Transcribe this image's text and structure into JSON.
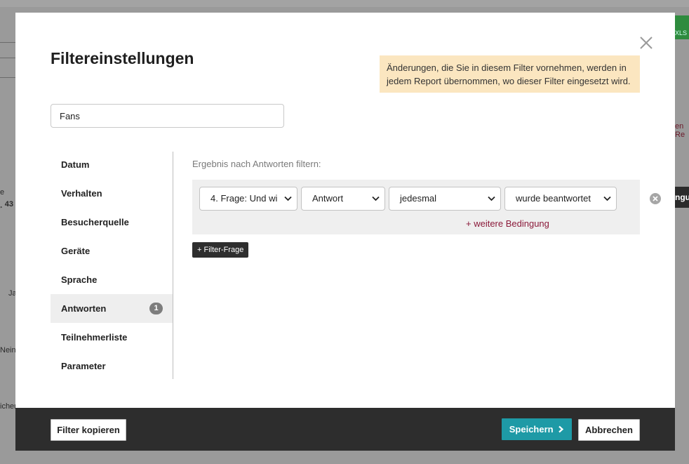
{
  "background": {
    "fragments": {
      "e": "e",
      "n43": "¸ 43",
      "ja": "Ja",
      "nein": "Nein",
      "icher": "icher",
      "enre": "en Re",
      "ngu": "ngu",
      "xls": "XLS"
    }
  },
  "modal": {
    "title": "Filtereinstellungen",
    "close_icon": "close-icon",
    "notice": "Änderungen, die Sie in diesem Filter vornehmen, werden in jedem Report übernommen, wo dieser Filter eingesetzt wird.",
    "filter_name": "Fans"
  },
  "nav": {
    "items": [
      {
        "label": "Datum"
      },
      {
        "label": "Verhalten"
      },
      {
        "label": "Besucherquelle"
      },
      {
        "label": "Geräte"
      },
      {
        "label": "Sprache"
      },
      {
        "label": "Antworten",
        "badge": "1"
      },
      {
        "label": "Teilnehmerliste"
      },
      {
        "label": "Parameter"
      }
    ]
  },
  "content": {
    "section_label": "Ergebnis nach Antworten filtern:",
    "condition": {
      "question": "4. Frage: Und wi",
      "field": "Antwort",
      "value": "jedesmal",
      "operator": "wurde beantwortet"
    },
    "more_condition": "+ weitere Bedingung",
    "add_question": "+ Filter-Frage"
  },
  "footer": {
    "copy_label": "Filter kopieren",
    "save_label": "Speichern",
    "cancel_label": "Abbrechen"
  },
  "colors": {
    "accent": "#1e9aa6",
    "link": "#8b1a3a",
    "notice_bg": "#fbe6c0",
    "footer_bg": "#2d2d2d"
  }
}
